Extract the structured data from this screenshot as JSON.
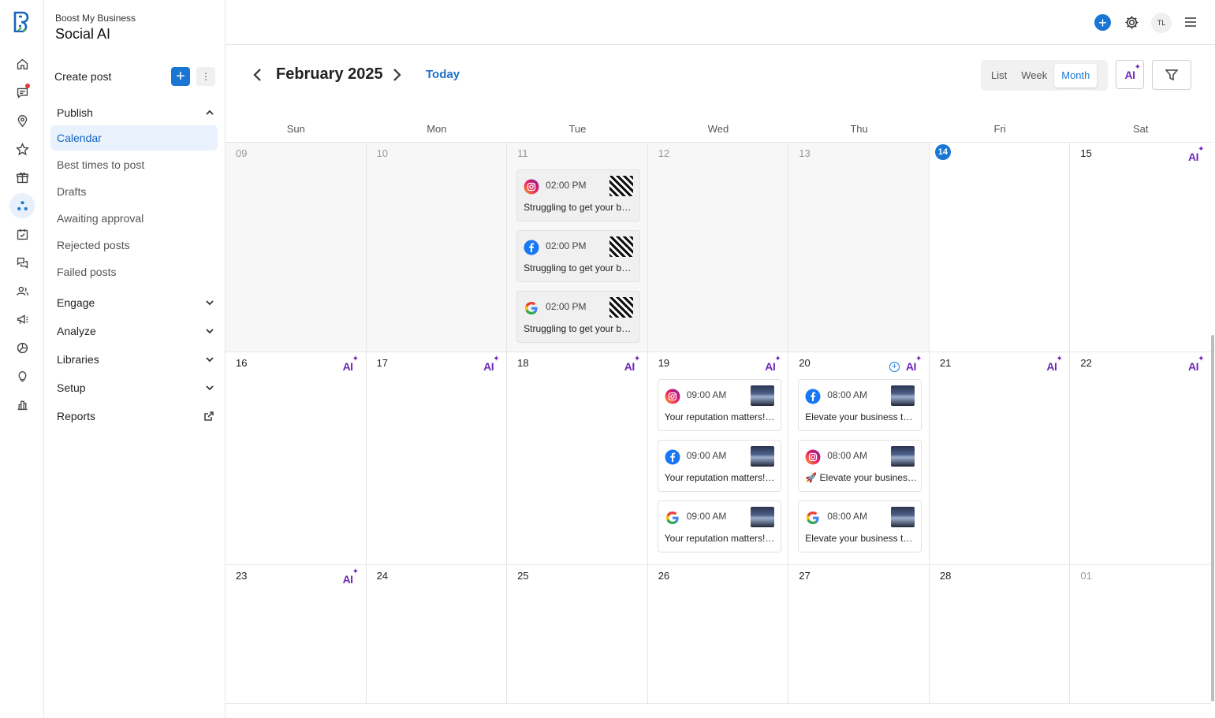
{
  "sidebar": {
    "brand_sub": "Boost My Business",
    "brand_title": "Social AI",
    "create_label": "Create post",
    "create_icon": "+",
    "more_icon": "⋮",
    "publish_label": "Publish",
    "publish_items": [
      "Calendar",
      "Best times to post",
      "Drafts",
      "Awaiting approval",
      "Rejected posts",
      "Failed posts"
    ],
    "groups": [
      "Engage",
      "Analyze",
      "Libraries",
      "Setup"
    ],
    "reports_label": "Reports"
  },
  "topbar": {
    "plus_icon": "+",
    "avatar": "TL"
  },
  "calendar": {
    "month": "February 2025",
    "today_label": "Today",
    "views": [
      "List",
      "Week",
      "Month"
    ],
    "active_view": "Month",
    "ai_label": "AI",
    "spark": "✦",
    "weekdays": [
      "Sun",
      "Mon",
      "Tue",
      "Wed",
      "Thu",
      "Fri",
      "Sat"
    ],
    "days": [
      {
        "num": "09",
        "past": true,
        "muted": true
      },
      {
        "num": "10",
        "past": true,
        "muted": true
      },
      {
        "num": "11",
        "past": true,
        "muted": true
      },
      {
        "num": "12",
        "past": true,
        "muted": true
      },
      {
        "num": "13",
        "past": true,
        "muted": true
      },
      {
        "num": "14",
        "today": true
      },
      {
        "num": "15",
        "ai": true
      },
      {
        "num": "16",
        "ai": true
      },
      {
        "num": "17",
        "ai": true
      },
      {
        "num": "18",
        "ai": true
      },
      {
        "num": "19",
        "ai": true
      },
      {
        "num": "20",
        "ai": true,
        "plus": true
      },
      {
        "num": "21",
        "ai": true
      },
      {
        "num": "22",
        "ai": true
      },
      {
        "num": "23",
        "ai": true
      },
      {
        "num": "24"
      },
      {
        "num": "25"
      },
      {
        "num": "26"
      },
      {
        "num": "27"
      },
      {
        "num": "28"
      },
      {
        "num": "01",
        "muted": true
      }
    ],
    "posts": {
      "11": [
        {
          "platform": "instagram",
          "time": "02:00 PM",
          "text": "Struggling to get your business noticed?",
          "thumb": "bw"
        },
        {
          "platform": "facebook",
          "time": "02:00 PM",
          "text": "Struggling to get your business noticed?",
          "thumb": "bw"
        },
        {
          "platform": "google",
          "time": "02:00 PM",
          "text": "Struggling to get your business noticed?",
          "thumb": "bw"
        }
      ],
      "19": [
        {
          "platform": "instagram",
          "time": "09:00 AM",
          "text": "Your reputation matters! Discover",
          "thumb": "night"
        },
        {
          "platform": "facebook",
          "time": "09:00 AM",
          "text": "Your reputation matters! Discover",
          "thumb": "night"
        },
        {
          "platform": "google",
          "time": "09:00 AM",
          "text": "Your reputation matters! Discover",
          "thumb": "night"
        }
      ],
      "20": [
        {
          "platform": "facebook",
          "time": "08:00 AM",
          "text": "Elevate your business to new heights",
          "thumb": "night"
        },
        {
          "platform": "instagram",
          "time": "08:00 AM",
          "text": "🚀 Elevate your business to new heights",
          "thumb": "night"
        },
        {
          "platform": "google",
          "time": "08:00 AM",
          "text": "Elevate your business to new heights",
          "thumb": "night"
        }
      ]
    }
  },
  "colors": {
    "accent": "#1976d2",
    "ai": "#6d28b8",
    "today": "#1976d2"
  }
}
